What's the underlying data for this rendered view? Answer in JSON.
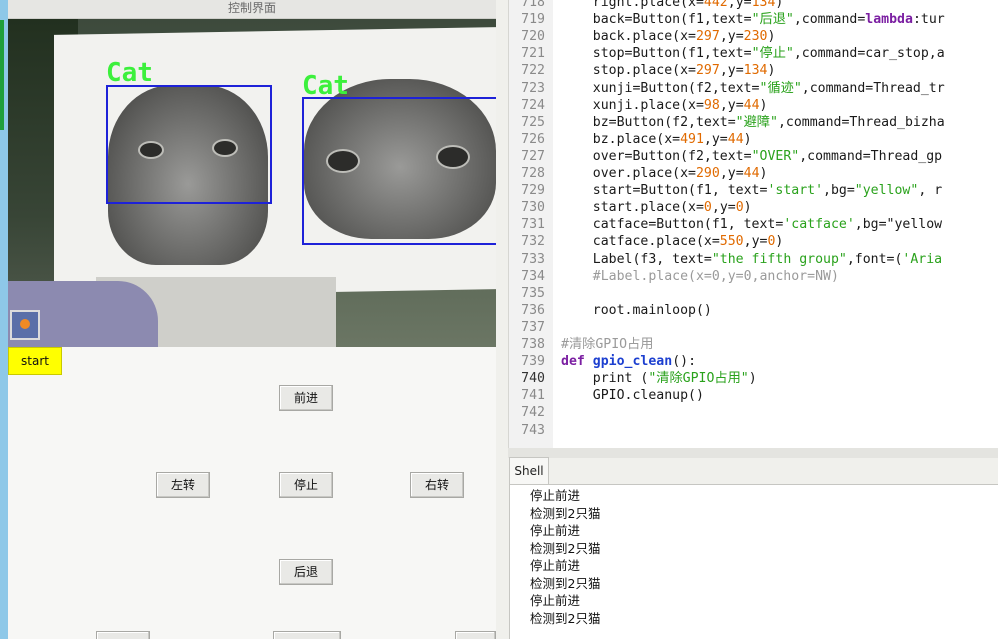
{
  "window": {
    "title": "控制界面"
  },
  "controls": {
    "start_label": "start",
    "forward_label": "前进",
    "left_label": "左转",
    "stop_label": "停止",
    "right_label": "右转",
    "back_label": "后退"
  },
  "camera": {
    "detections": [
      {
        "label": "Cat"
      },
      {
        "label": "Cat"
      }
    ]
  },
  "colors": {
    "start_button": "#ffff00",
    "detection_box": "#1e22d8",
    "detection_label": "#3cf03c",
    "string": "#2aa21c",
    "number": "#e06a00",
    "keyword": "#7b1fa2",
    "comment": "#9a9a9a"
  },
  "editor": {
    "lines": [
      {
        "no": "718",
        "t": [
          [
            "    right.place(x=",
            ""
          ],
          [
            "442",
            "n"
          ],
          [
            ",y=",
            ""
          ],
          [
            "134",
            "n"
          ],
          [
            ")",
            ""
          ]
        ]
      },
      {
        "no": "719",
        "t": [
          [
            "    back=Button(f1,text=",
            ""
          ],
          [
            "\"后退\"",
            "s"
          ],
          [
            ",command=",
            ""
          ],
          [
            "lambda",
            "k"
          ],
          [
            ":tur",
            ""
          ]
        ]
      },
      {
        "no": "720",
        "t": [
          [
            "    back.place(x=",
            ""
          ],
          [
            "297",
            "n"
          ],
          [
            ",y=",
            ""
          ],
          [
            "230",
            "n"
          ],
          [
            ")",
            ""
          ]
        ]
      },
      {
        "no": "721",
        "t": [
          [
            "    stop=Button(f1,text=",
            ""
          ],
          [
            "\"停止\"",
            "s"
          ],
          [
            ",command=car_stop,a",
            ""
          ]
        ]
      },
      {
        "no": "722",
        "t": [
          [
            "    stop.place(x=",
            ""
          ],
          [
            "297",
            "n"
          ],
          [
            ",y=",
            ""
          ],
          [
            "134",
            "n"
          ],
          [
            ")",
            ""
          ]
        ]
      },
      {
        "no": "723",
        "t": [
          [
            "    xunji=Button(f2,text=",
            ""
          ],
          [
            "\"循迹\"",
            "s"
          ],
          [
            ",command=Thread_tr",
            ""
          ]
        ]
      },
      {
        "no": "724",
        "t": [
          [
            "    xunji.place(x=",
            ""
          ],
          [
            "98",
            "n"
          ],
          [
            ",y=",
            ""
          ],
          [
            "44",
            "n"
          ],
          [
            ")",
            ""
          ]
        ]
      },
      {
        "no": "725",
        "t": [
          [
            "    bz=Button(f2,text=",
            ""
          ],
          [
            "\"避障\"",
            "s"
          ],
          [
            ",command=Thread_bizha",
            ""
          ]
        ]
      },
      {
        "no": "726",
        "t": [
          [
            "    bz.place(x=",
            ""
          ],
          [
            "491",
            "n"
          ],
          [
            ",y=",
            ""
          ],
          [
            "44",
            "n"
          ],
          [
            ")",
            ""
          ]
        ]
      },
      {
        "no": "727",
        "t": [
          [
            "    over=Button(f2,text=",
            ""
          ],
          [
            "\"OVER\"",
            "s"
          ],
          [
            ",command=Thread_gp",
            ""
          ]
        ]
      },
      {
        "no": "728",
        "t": [
          [
            "    over.place(x=",
            ""
          ],
          [
            "290",
            "n"
          ],
          [
            ",y=",
            ""
          ],
          [
            "44",
            "n"
          ],
          [
            ")",
            ""
          ]
        ]
      },
      {
        "no": "729",
        "t": [
          [
            "    start=Button(f1, text=",
            ""
          ],
          [
            "'start'",
            "s"
          ],
          [
            ",bg=",
            ""
          ],
          [
            "\"yellow\"",
            "s"
          ],
          [
            ", r",
            ""
          ]
        ]
      },
      {
        "no": "730",
        "t": [
          [
            "    start.place(x=",
            ""
          ],
          [
            "0",
            "n"
          ],
          [
            ",y=",
            ""
          ],
          [
            "0",
            "n"
          ],
          [
            ")",
            ""
          ]
        ]
      },
      {
        "no": "731",
        "t": [
          [
            "    catface=Button(f1, text=",
            ""
          ],
          [
            "'catface'",
            "s"
          ],
          [
            ",bg=",
            ""
          ],
          [
            "\"yellow",
            ""
          ]
        ]
      },
      {
        "no": "732",
        "t": [
          [
            "    catface.place(x=",
            ""
          ],
          [
            "550",
            "n"
          ],
          [
            ",y=",
            ""
          ],
          [
            "0",
            "n"
          ],
          [
            ")",
            ""
          ]
        ]
      },
      {
        "no": "733",
        "t": [
          [
            "    Label(f3, text=",
            ""
          ],
          [
            "\"the fifth group\"",
            "s"
          ],
          [
            ",font=(",
            ""
          ],
          [
            "'Aria",
            "s"
          ]
        ]
      },
      {
        "no": "734",
        "t": [
          [
            "    #Label.place(x=0,y=0,anchor=NW)",
            "c"
          ]
        ]
      },
      {
        "no": "735",
        "t": []
      },
      {
        "no": "736",
        "t": [
          [
            "    root.mainloop()",
            ""
          ]
        ]
      },
      {
        "no": "737",
        "t": []
      },
      {
        "no": "738",
        "t": [
          [
            "#清除GPIO占用",
            "c"
          ]
        ]
      },
      {
        "no": "739",
        "t": [
          [
            "def",
            "k"
          ],
          [
            " ",
            ""
          ],
          [
            "gpio_clean",
            "f"
          ],
          [
            "():",
            ""
          ]
        ]
      },
      {
        "no": "740",
        "t": [
          [
            "    print (",
            ""
          ],
          [
            "\"清除GPIO占用\"",
            "s"
          ],
          [
            ")",
            ""
          ]
        ],
        "active": true
      },
      {
        "no": "741",
        "t": [
          [
            "    GPIO.cleanup()",
            ""
          ]
        ]
      },
      {
        "no": "742",
        "t": []
      },
      {
        "no": "743",
        "t": []
      }
    ]
  },
  "shell": {
    "tab_label": "Shell",
    "lines": [
      "停止前进",
      "检测到2只猫",
      "停止前进",
      "检测到2只猫",
      "停止前进",
      "检测到2只猫",
      "停止前进",
      "检测到2只猫"
    ]
  }
}
